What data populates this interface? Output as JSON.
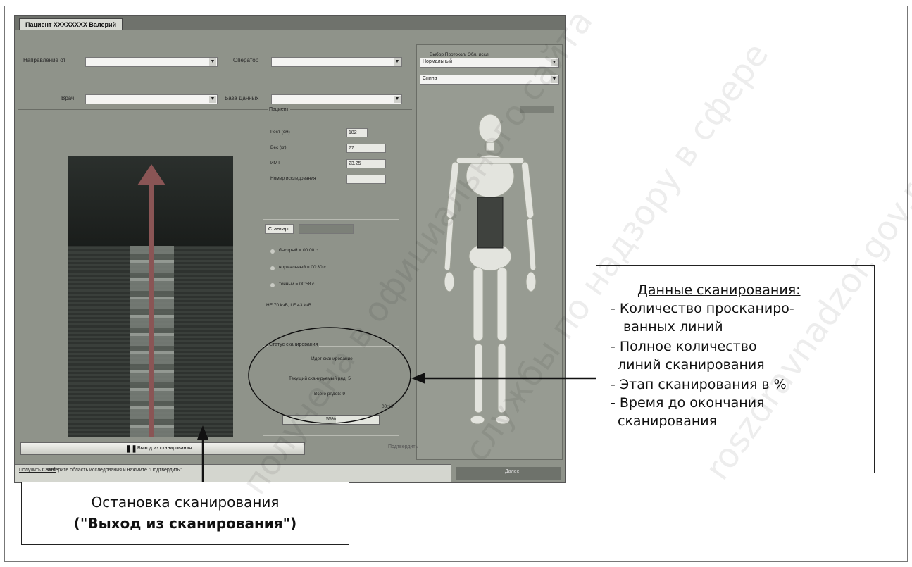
{
  "window": {
    "tab_title": "Пациент XXXXXXXX Валерий"
  },
  "top_form": {
    "referred_from_label": "Направление от",
    "operator_label": "Оператор",
    "doctor_label": "Врач",
    "database_label": "База Данных"
  },
  "patient": {
    "group_title": "Пациент",
    "height_label": "Рост (см)",
    "height_value": "182",
    "weight_label": "Вес (кг)",
    "weight_value": "77",
    "bmi_label": "ИМТ",
    "bmi_value": "23.25",
    "study_number_label": "Номер исследования"
  },
  "scan_mode": {
    "tab_standard": "Стандарт",
    "option_fast": "быстрый = 00:00 с",
    "option_normal": "нормальный = 00:30 с",
    "option_precise": "точный = 00:58 с",
    "energy": "HE 70 kэB, LE 43 kэB"
  },
  "scan_status": {
    "group_title": "Статус сканирования",
    "status_text": "Идет сканирование",
    "current_row": "Текущий сканируемый ряд: 5",
    "total_rows": "Всего рядов: 9",
    "progress_label": "55%",
    "progress_fraction": 0.55,
    "time_left": "00:13"
  },
  "protocol": {
    "title": "Выбор Протокол/ Обл. иссл.",
    "protocol_value": "Нормальный",
    "region_value": "Спина"
  },
  "bottom": {
    "stop_button_label": "Выход из сканирования",
    "confirm_button_label": "Подтвердить",
    "help_link": "Получить Совет",
    "status_message": ": Выберите область исследования и нажмите \"Подтвердить\"",
    "next_button_label": "Далее"
  },
  "annotations": {
    "right_title": "Данные сканирования:",
    "right_lines": [
      "- Количество просканиро-",
      "ванных линий",
      "- Полное количество",
      "линий сканирования",
      "- Этап сканирования в %",
      "- Время до окончания",
      "сканирования"
    ],
    "bottom_line1": "Остановка сканирования",
    "bottom_line2_open": "(\"",
    "bottom_line2_bold": "Выход из сканирования",
    "bottom_line2_close": "\")"
  },
  "watermark": {
    "line1": "получена в официального сайта",
    "line2": "службы по надзору в сфере",
    "line3": "roszdravnadzor.gov.ru"
  }
}
